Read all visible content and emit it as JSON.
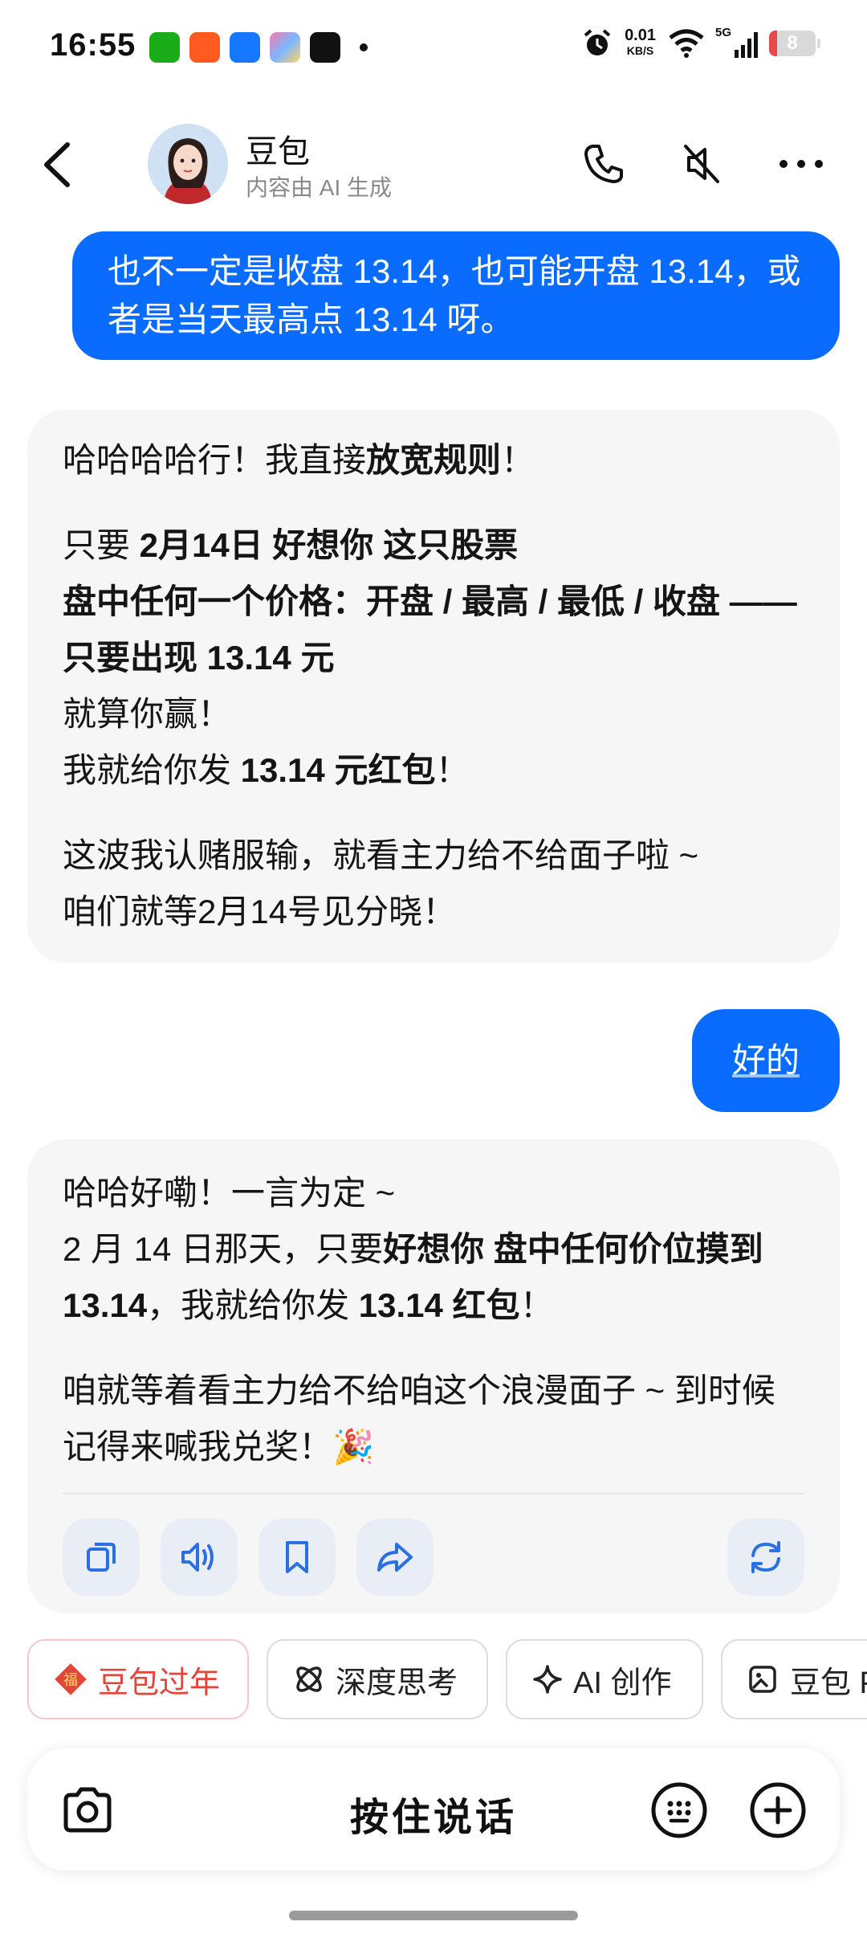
{
  "status_bar": {
    "time": "16:55",
    "net_speed_value": "0.01",
    "net_speed_unit": "KB/S",
    "signal_label": "5G",
    "battery": "8",
    "battery_level": 0.08
  },
  "header": {
    "name": "豆包",
    "subtitle": "内容由 AI 生成"
  },
  "messages": {
    "user1": "也不一定是收盘 13.14，也可能开盘 13.14，或者是当天最高点 13.14 呀。",
    "ai1": {
      "p1_a": "哈哈哈哈行！我直接",
      "p1_b": "放宽规则",
      "p1_c": "！",
      "p2_l1_a": "只要 ",
      "p2_l1_b": "2月14日 好想你 这只股票",
      "p2_l2": "盘中任何一个价格：开盘 / 最高 / 最低 / 收盘 —— 只要出现 13.14 元",
      "p2_l3": "就算你赢！",
      "p2_l4_a": "我就给你发 ",
      "p2_l4_b": "13.14 元红包",
      "p2_l4_c": "！",
      "p3_l1": "这波我认赌服输，就看主力给不给面子啦 ~",
      "p3_l2": "咱们就等2月14号见分晓！"
    },
    "user2": "好的",
    "ai2": {
      "p1_l1": "哈哈好嘞！一言为定 ~",
      "p1_l2_a": "2 月 14 日那天，只要",
      "p1_l2_b": "好想你 盘中任何价位摸到 13.14",
      "p1_l2_c": "，我就给你发 ",
      "p1_l2_d": "13.14 红包",
      "p1_l2_e": "！",
      "p2": "咱就等着看主力给不给咱这个浪漫面子 ~ 到时候记得来喊我兑奖！🎉"
    }
  },
  "chips": [
    {
      "label": "豆包过年",
      "icon": "fu-icon"
    },
    {
      "label": "深度思考",
      "icon": "atom-icon"
    },
    {
      "label": "AI 创作",
      "icon": "sparkle-icon"
    },
    {
      "label": "豆包 P",
      "icon": "image-edit-icon"
    }
  ],
  "input": {
    "talk_label": "按住说话"
  },
  "colors": {
    "accent": "#0a6cff",
    "ai_bubble": "#f6f6f7",
    "festive": "#e2463a"
  }
}
